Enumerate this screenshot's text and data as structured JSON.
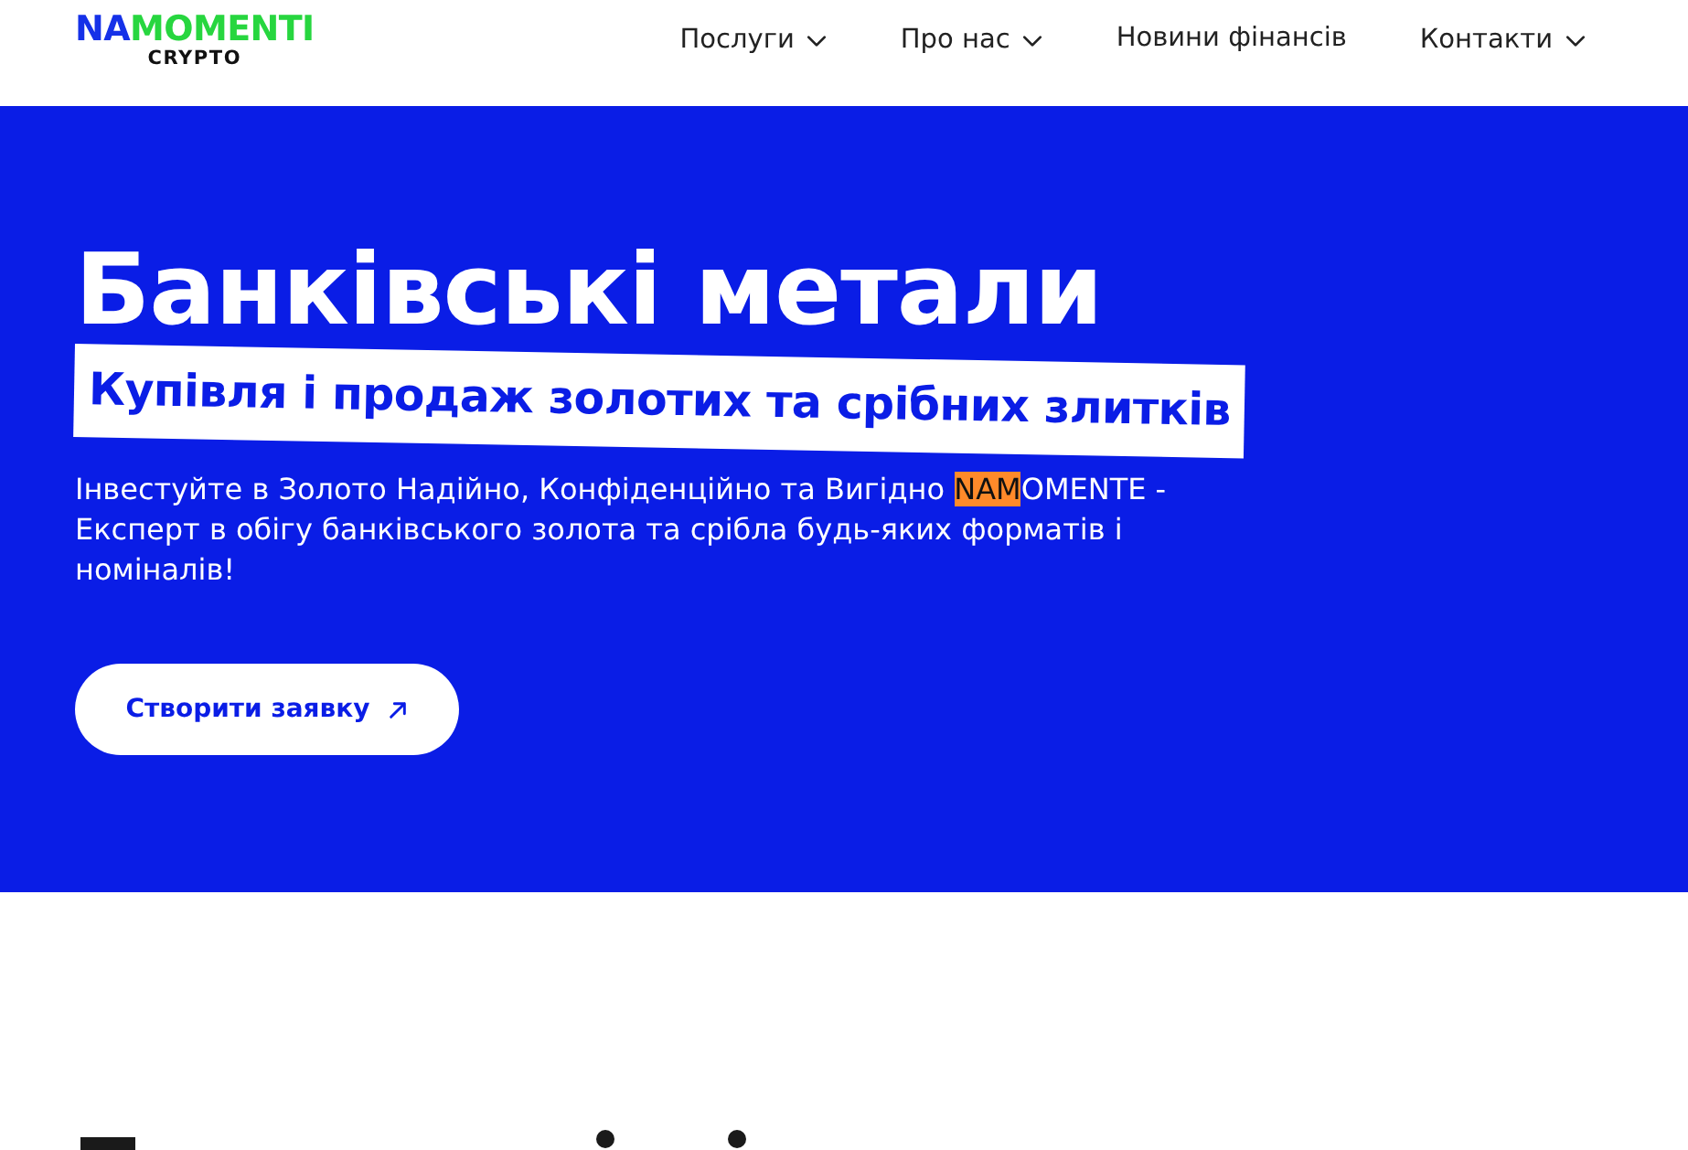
{
  "header": {
    "logo": {
      "parts": [
        {
          "text": "NA",
          "color": "#1531e8"
        },
        {
          "text": "MOMENTI",
          "color": "#27d63f"
        }
      ],
      "tagline": "CRYPTO"
    },
    "nav": [
      {
        "label": "Послуги",
        "kind": "dropdown"
      },
      {
        "label": "Про нас",
        "kind": "dropdown"
      },
      {
        "label": "Новини фінансів",
        "kind": "link"
      },
      {
        "label": "Контакти",
        "kind": "dropdown"
      }
    ]
  },
  "hero": {
    "title": "Банківські метали",
    "subtitle": "Купівля і продаж золотих та срібних злитків",
    "description": [
      {
        "text": "Інвестуйте в Золото Надійно, Конфіденційно та Вигідно ",
        "highlighted": false
      },
      {
        "text": "NAM",
        "highlighted": true
      },
      {
        "text": "OMENTE - Експерт в обігу банківського золота та срібла будь-яких форматів і номіналів!",
        "highlighted": false
      }
    ],
    "button": {
      "label": "Створити заявку"
    }
  }
}
